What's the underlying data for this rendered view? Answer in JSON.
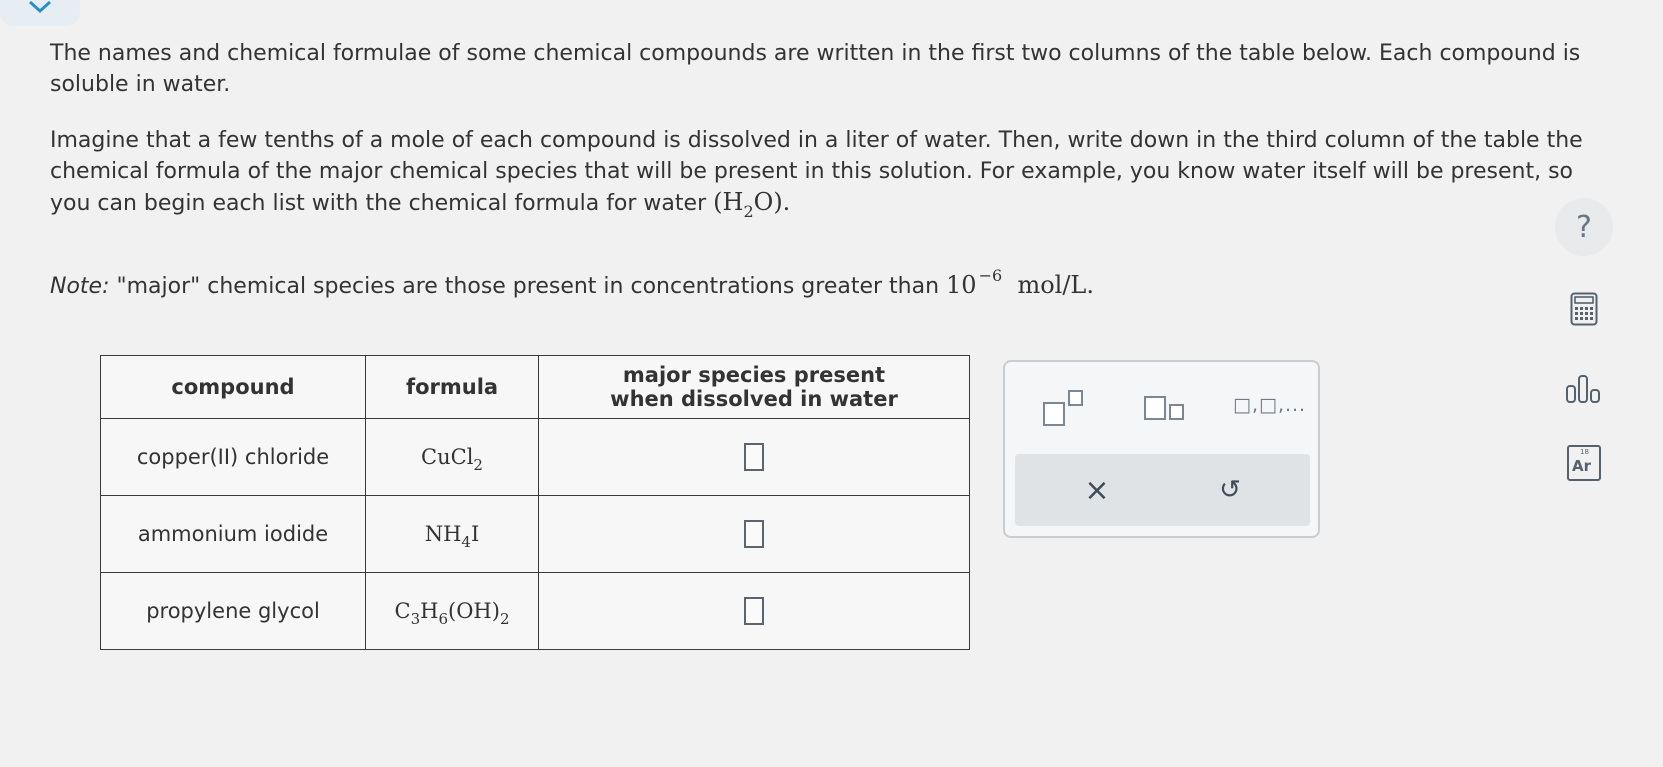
{
  "question": {
    "paragraph1": "The names and chemical formulae of some chemical compounds are written in the first two columns of the table below. Each compound is soluble in water.",
    "paragraph2": "Imagine that a few tenths of a mole of each compound is dissolved in a liter of water. Then, write down in the third column of the table the chemical formula of the major chemical species that will be present in this solution. For example, you know water itself will be present, so you can begin each list with the chemical formula for water",
    "water_formula": {
      "h": "H",
      "sub": "2",
      "o": "O",
      "open": "(",
      "close": ")."
    },
    "note_label": "Note:",
    "note_text": " \"major\" chemical species are those present in concentrations greater than ",
    "note_base": "10",
    "note_exp": "−6",
    "note_unit": "mol/L."
  },
  "table": {
    "headers": {
      "compound": "compound",
      "formula": "formula",
      "major_line1": "major species present",
      "major_line2": "when dissolved in water"
    },
    "rows": [
      {
        "compound": "copper(II) chloride",
        "formula_parts": [
          "CuCl",
          "2",
          ""
        ]
      },
      {
        "compound": "ammonium iodide",
        "formula_parts": [
          "NH",
          "4",
          "I"
        ]
      },
      {
        "compound": "propylene glycol",
        "formula_parts": [
          "C",
          "3",
          "H",
          "6",
          "(OH)",
          "2"
        ]
      }
    ]
  },
  "toolbar": {
    "list_label": "□,□,...",
    "clear_symbol": "×",
    "undo_symbol": "↺"
  },
  "side_tools": {
    "help_label": "?",
    "periodic_label": "Ar",
    "periodic_number": "18"
  }
}
